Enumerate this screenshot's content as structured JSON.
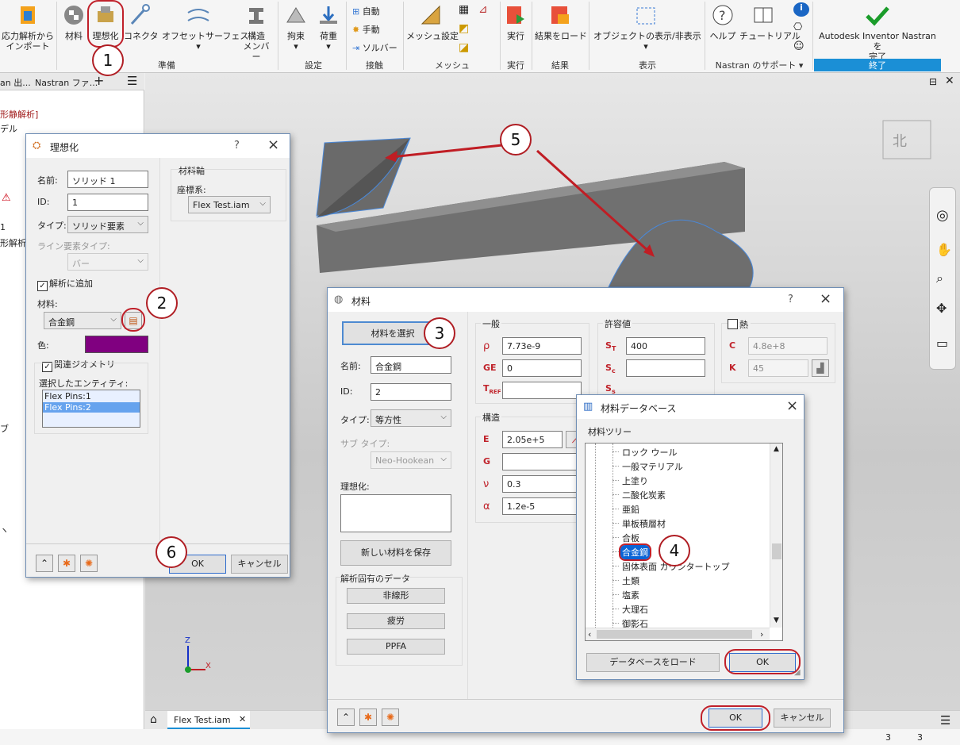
{
  "ribbon": {
    "import_label": "応力解析から\nインポート",
    "material": "材料",
    "idealize": "理想化",
    "connector": "コネクタ",
    "offset_surface": "オフセットサーフェス",
    "structural_member": "構造\nメンバー",
    "constraint": "拘束",
    "load": "荷重",
    "auto": "自動",
    "manual": "手動",
    "solver": "ソルバー",
    "mesh_settings": "メッシュ設定",
    "run": "実行",
    "load_results": "結果をロード",
    "show_hide": "オブジェクトの表示/非表示",
    "help": "ヘルプ",
    "tutorial": "チュートリアル",
    "finish": "Autodesk Inventor Nastran を\n完了",
    "groups": {
      "prepare": "準備",
      "settings": "設定",
      "contact": "接触",
      "mesh": "メッシュ",
      "run": "実行",
      "results": "結果",
      "display": "表示",
      "support": "Nastran のサポート ▾",
      "end": "終了"
    }
  },
  "browser": {
    "tab1": "an 出...",
    "tab2": "Nastran ファ...",
    "plus": "+",
    "line1": "形静解析]",
    "line2": "デル",
    "line3": "1",
    "line4": "形解析",
    "line5": "ブ",
    "line6": "ヽ"
  },
  "idealize_dialog": {
    "title": "理想化",
    "q": "?",
    "name_label": "名前:",
    "name_value": "ソリッド 1",
    "id_label": "ID:",
    "id_value": "1",
    "type_label": "タイプ:",
    "type_value": "ソリッド要素",
    "line_type_label": "ライン要素タイプ:",
    "line_type_value": "バー",
    "add_to_analysis": "解析に追加",
    "material_label": "材料:",
    "material_value": "合金鋼",
    "color_label": "色:",
    "related_geom": "関連ジオメトリ",
    "selected_entities_label": "選択したエンティティ:",
    "entities": [
      "Flex Pins:1",
      "Flex Pins:2"
    ],
    "material_axis_label": "材料軸",
    "coord_label": "座標系:",
    "coord_value": "Flex Test.iam",
    "ok": "OK",
    "cancel": "キャンセル",
    "color_hex": "#800080"
  },
  "material_dialog": {
    "title": "材料",
    "q": "?",
    "select_btn": "材料を選択",
    "name_label": "名前:",
    "name_value": "合金鋼",
    "id_label": "ID:",
    "id_value": "2",
    "type_label": "タイプ:",
    "type_value": "等方性",
    "subtype_label": "サブ タイプ:",
    "subtype_value": "Neo-Hookean",
    "idealize_label": "理想化:",
    "save_btn": "新しい材料を保存",
    "analysis_data_label": "解析固有のデータ",
    "nonlinear": "非線形",
    "fatigue": "疲労",
    "ppfa": "PPFA",
    "general_label": "一般",
    "rho": "7.73e-9",
    "ge": "0",
    "tref": "",
    "allow_label": "許容値",
    "st": "400",
    "sc": "",
    "ss": "",
    "heat_label": "熱",
    "c_val": "4.8e+8",
    "k_val": "45",
    "struct_label": "構造",
    "e_val": "2.05e+5",
    "g_val": "",
    "nu_val": "0.3",
    "alpha_val": "1.2e-5",
    "ok": "OK",
    "cancel": "キャンセル"
  },
  "db_dialog": {
    "title": "材料データベース",
    "tree_label": "材料ツリー",
    "items": [
      "ロック ウール",
      "一般マテリアル",
      "上塗り",
      "二酸化炭素",
      "亜鉛",
      "単板積層材",
      "合板",
      "合金鋼",
      "固体表面 カウンタートップ",
      "土類",
      "塩素",
      "大理石",
      "御影石"
    ],
    "load_db": "データベースをロード",
    "ok": "OK"
  },
  "callouts": [
    "1",
    "2",
    "3",
    "4",
    "5",
    "6"
  ],
  "tabs": {
    "file": "Flex Test.iam",
    "close": "✕"
  },
  "status": {
    "a": "3",
    "b": "3"
  }
}
